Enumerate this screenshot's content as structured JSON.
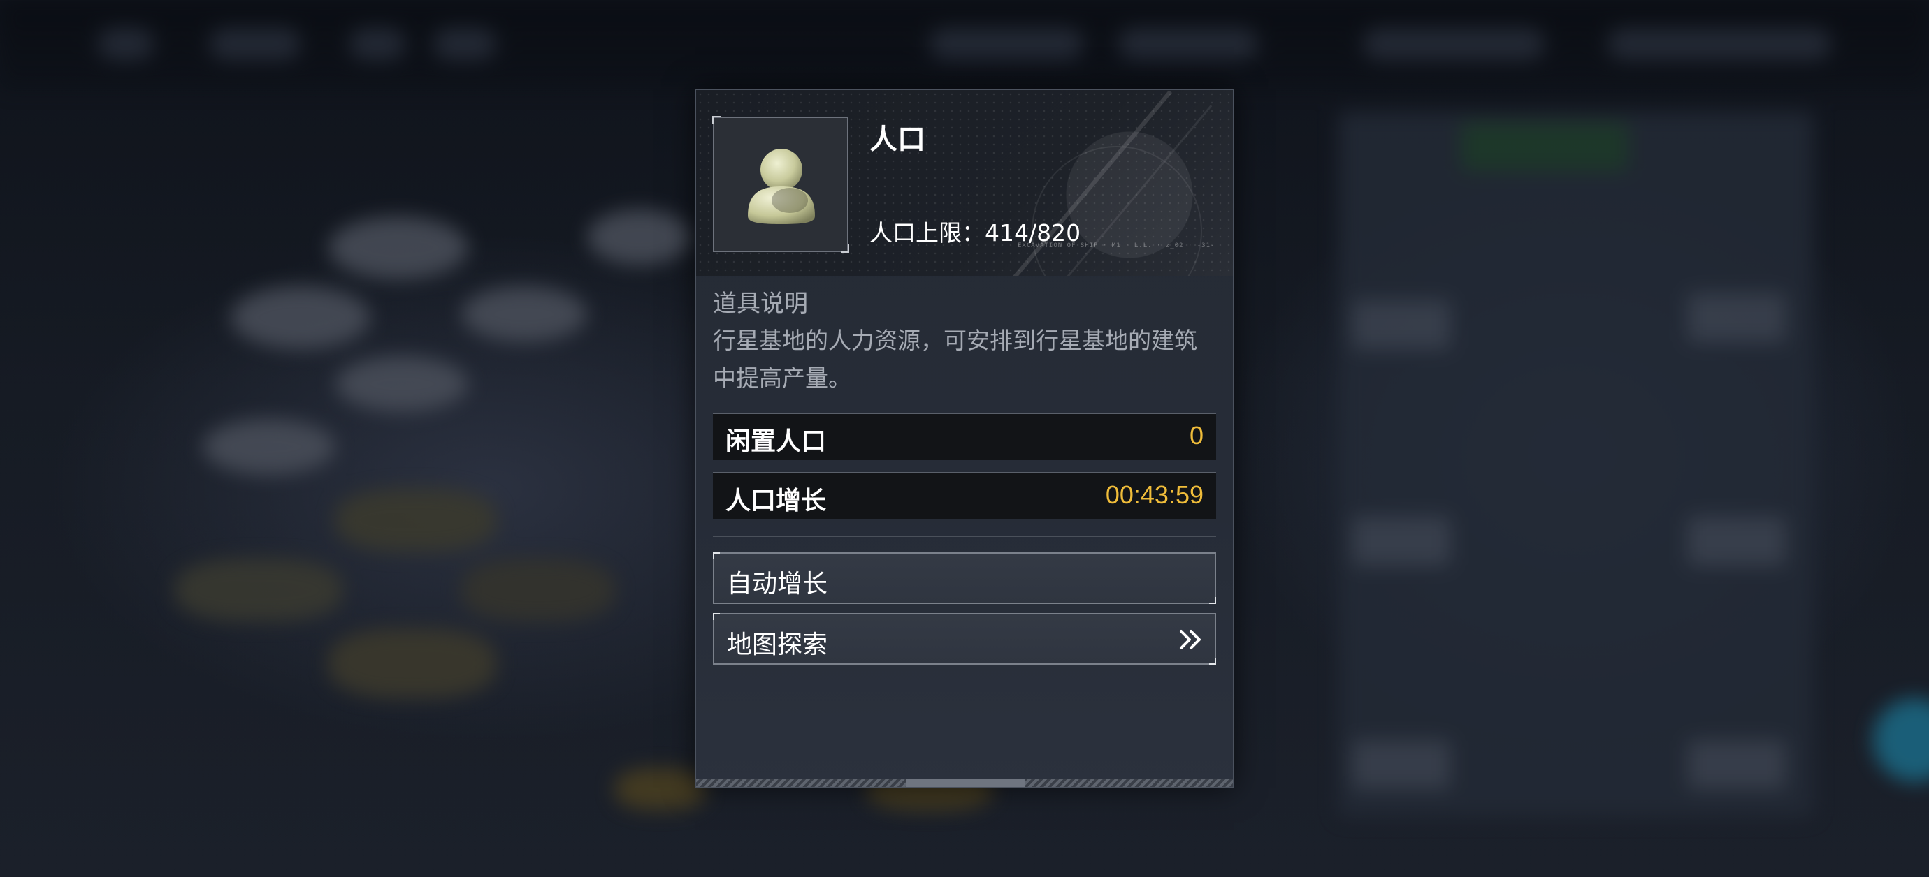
{
  "popup": {
    "title": "人口",
    "cap_label": "人口上限：",
    "cap_value": "414/820",
    "header_deco": "EXCAVATION OF SHIP   ·   M1   ·  L.L.   ·   z_02   ·  -31-",
    "description": {
      "heading": "道具说明",
      "text": "行星基地的人力资源，可安排到行星基地的建筑中提高产量。"
    },
    "stats": [
      {
        "label": "闲置人口",
        "value": "0"
      },
      {
        "label": "人口增长",
        "value": "00:43:59"
      }
    ],
    "actions": [
      {
        "label": "自动增长"
      },
      {
        "label": "地图探索",
        "icon": "double-chevron-right-icon"
      }
    ]
  },
  "colors": {
    "accent_value": "#f0bd3a",
    "panel_bg": "#252b36",
    "stat_row_bg": "#121417",
    "text_muted": "#a6abb4"
  },
  "icons": {
    "population": "person-silhouette-icon",
    "map_explore_arrow": "double-chevron-right-icon"
  }
}
